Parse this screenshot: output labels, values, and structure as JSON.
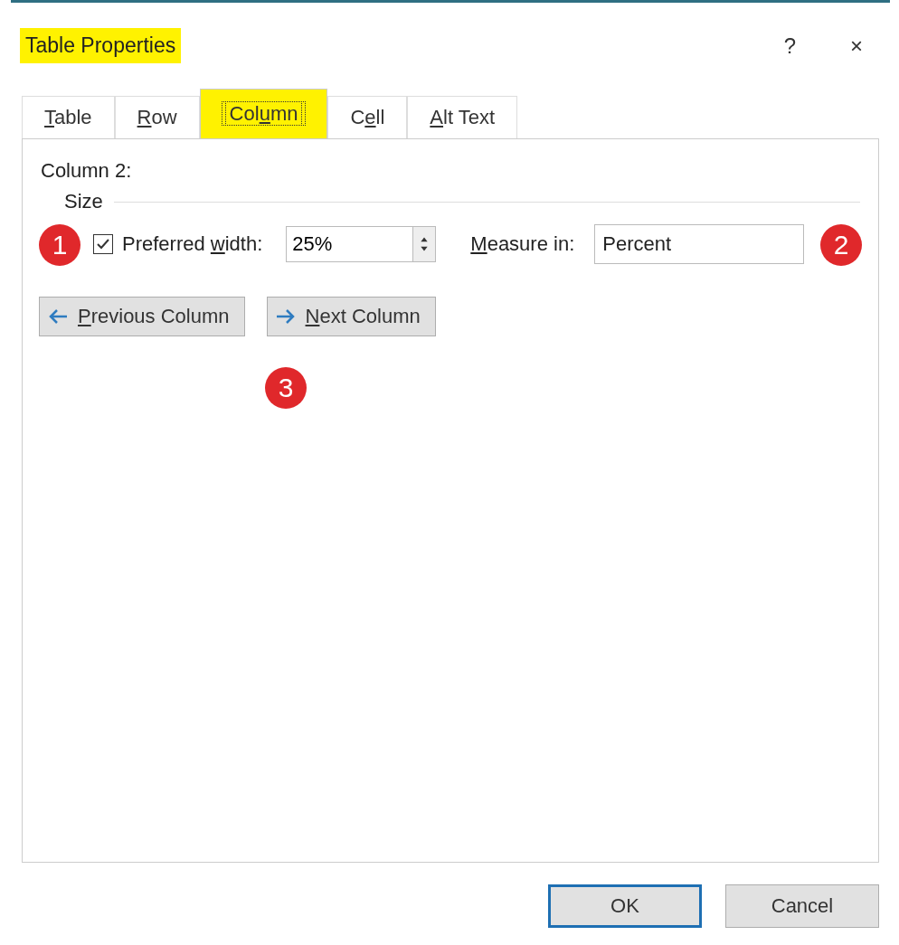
{
  "window": {
    "title": "Table Properties",
    "title_highlighted": true,
    "help": "?",
    "close": "×"
  },
  "tabs": [
    {
      "label": {
        "key": "T",
        "post": "able"
      },
      "selected": false,
      "highlighted": false
    },
    {
      "label": {
        "key": "R",
        "post": "ow"
      },
      "selected": false,
      "highlighted": false
    },
    {
      "label": {
        "pre": "Col",
        "key": "u",
        "post": "mn"
      },
      "selected": true,
      "highlighted": true
    },
    {
      "label": {
        "pre": "C",
        "key": "e",
        "post": "ll"
      },
      "selected": false,
      "highlighted": false
    },
    {
      "label": {
        "key": "A",
        "post": "lt Text"
      },
      "selected": false,
      "highlighted": false
    }
  ],
  "panel": {
    "heading": "Column 2:",
    "group": "Size",
    "preferred_width": {
      "checked": true,
      "label": {
        "pre": "Preferred ",
        "key": "w",
        "post": "idth:"
      },
      "value": "25%"
    },
    "measure_in": {
      "label": {
        "key": "M",
        "post": "easure in:"
      },
      "value": "Percent"
    },
    "nav_buttons": [
      {
        "kind": "previous",
        "label": {
          "key": "P",
          "post": "revious Column"
        }
      },
      {
        "kind": "next",
        "label": {
          "key": "N",
          "post": "ext Column"
        }
      }
    ]
  },
  "annotations": [
    {
      "number": "1"
    },
    {
      "number": "2"
    },
    {
      "number": "3"
    }
  ],
  "buttons": [
    {
      "label": "OK",
      "default": true
    },
    {
      "label": "Cancel",
      "default": false
    }
  ]
}
